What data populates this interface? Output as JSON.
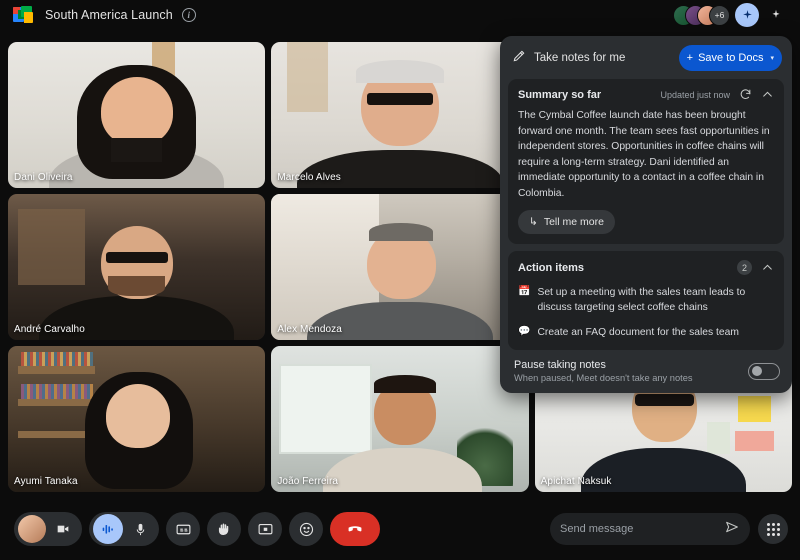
{
  "header": {
    "logo_icon": "google-meet-logo",
    "title": "South America Launch",
    "info_icon": "info-icon",
    "participant_overflow": "+6",
    "gemini_icon": "gemini-sparkle-icon",
    "effects_icon": "sparkle-icon"
  },
  "participants": [
    {
      "name": "Dani Oliveira"
    },
    {
      "name": "Marcelo Alves"
    },
    {
      "name": "André Carvalho"
    },
    {
      "name": "Alex Mendoza"
    },
    {
      "name": "Ayumi Tanaka"
    },
    {
      "name": "João Ferreira"
    },
    {
      "name": "Apichat Naksuk"
    }
  ],
  "notes_panel": {
    "pen_icon": "take-notes-icon",
    "title": "Take notes for me",
    "save_button": {
      "plus": "+",
      "label": "Save to Docs",
      "caret": "▾"
    },
    "summary": {
      "title": "Summary so far",
      "updated": "Updated just now",
      "refresh_icon": "refresh-icon",
      "collapse_icon": "chevron-up-icon",
      "body": "The Cymbal Coffee launch date has been brought forward one month. The team sees fast opportunities in independent stores. Opportunities in coffee chains will require a long-term strategy. Dani identified an immediate opportunity to a contact in a coffee chain in Colombia.",
      "tell_more": {
        "icon": "↳",
        "label": "Tell me more"
      }
    },
    "action_items": {
      "title": "Action items",
      "count": "2",
      "collapse_icon": "chevron-up-icon",
      "items": [
        {
          "icon": "calendar-icon",
          "glyph": "📅",
          "text": "Set up a meeting with the sales team leads to discuss targeting select coffee chains"
        },
        {
          "icon": "chat-bubble-icon",
          "glyph": "💬",
          "text": "Create an FAQ document for the sales team"
        }
      ]
    },
    "pause": {
      "title": "Pause taking notes",
      "subtitle": "When paused, Meet doesn't take any notes",
      "toggle_state": "off"
    }
  },
  "controls": {
    "camera_icon": "camera-icon",
    "audio_icon": "audio-waveform-icon",
    "mic_icon": "microphone-icon",
    "captions_icon": "closed-captions-icon",
    "raise_hand_icon": "raise-hand-icon",
    "present_icon": "present-screen-icon",
    "emoji_icon": "emoji-reaction-icon",
    "end_call_icon": "end-call-icon"
  },
  "message_bar": {
    "placeholder": "Send message",
    "send_icon": "send-icon",
    "apps_icon": "apps-grid-icon"
  }
}
